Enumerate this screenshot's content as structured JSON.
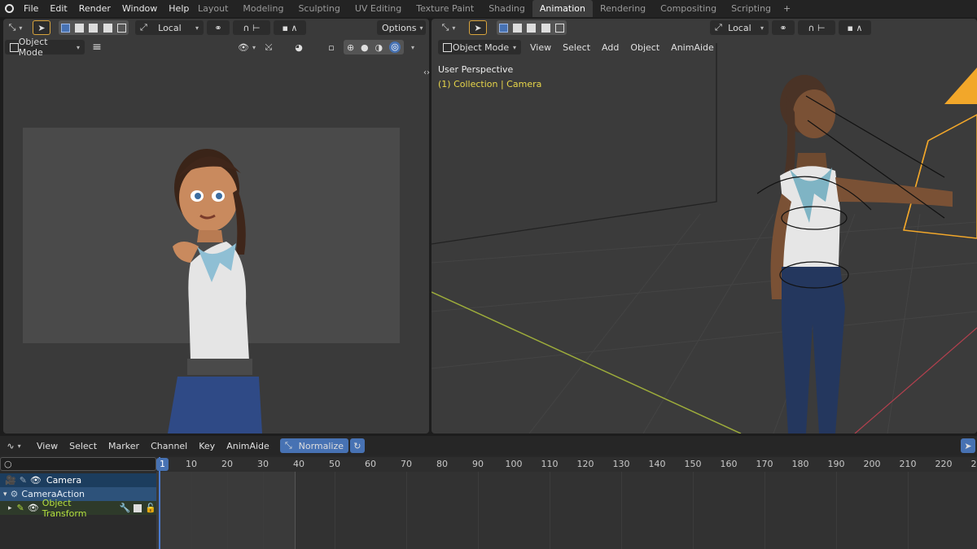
{
  "menu": {
    "items": [
      "File",
      "Edit",
      "Render",
      "Window",
      "Help"
    ]
  },
  "workspaces": [
    "Layout",
    "Modeling",
    "Sculpting",
    "UV Editing",
    "Texture Paint",
    "Shading",
    "Animation",
    "Rendering",
    "Compositing",
    "Scripting"
  ],
  "workspace_add": "+",
  "left_view": {
    "transform_orientation": "Local",
    "options_label": "Options",
    "mode": "Object Mode"
  },
  "right_view": {
    "transform_orientation": "Local",
    "mode": "Object Mode",
    "menus": [
      "View",
      "Select",
      "Add",
      "Object",
      "AnimAide"
    ],
    "perspective_label": "User Perspective",
    "collection_label": "(1) Collection | Camera"
  },
  "timeline": {
    "menus": [
      "View",
      "Select",
      "Marker",
      "Channel",
      "Key",
      "AnimAide"
    ],
    "normalize_label": "Normalize",
    "current_frame": "1",
    "ruler_ticks": [
      "10",
      "20",
      "30",
      "40",
      "50",
      "60",
      "70",
      "80",
      "90",
      "100",
      "110",
      "120",
      "130",
      "140",
      "150",
      "160",
      "170",
      "180",
      "190",
      "200",
      "210",
      "220",
      "2"
    ],
    "channels": [
      {
        "name": "Camera",
        "level": 0
      },
      {
        "name": "CameraAction",
        "level": 1
      },
      {
        "name": "Object Transform",
        "level": 2
      }
    ]
  },
  "colors": {
    "accent": "#4772b3",
    "active_collection": "#e8d64a",
    "channel_green": "#b5e03f",
    "camera_outline": "#f2a72a"
  }
}
